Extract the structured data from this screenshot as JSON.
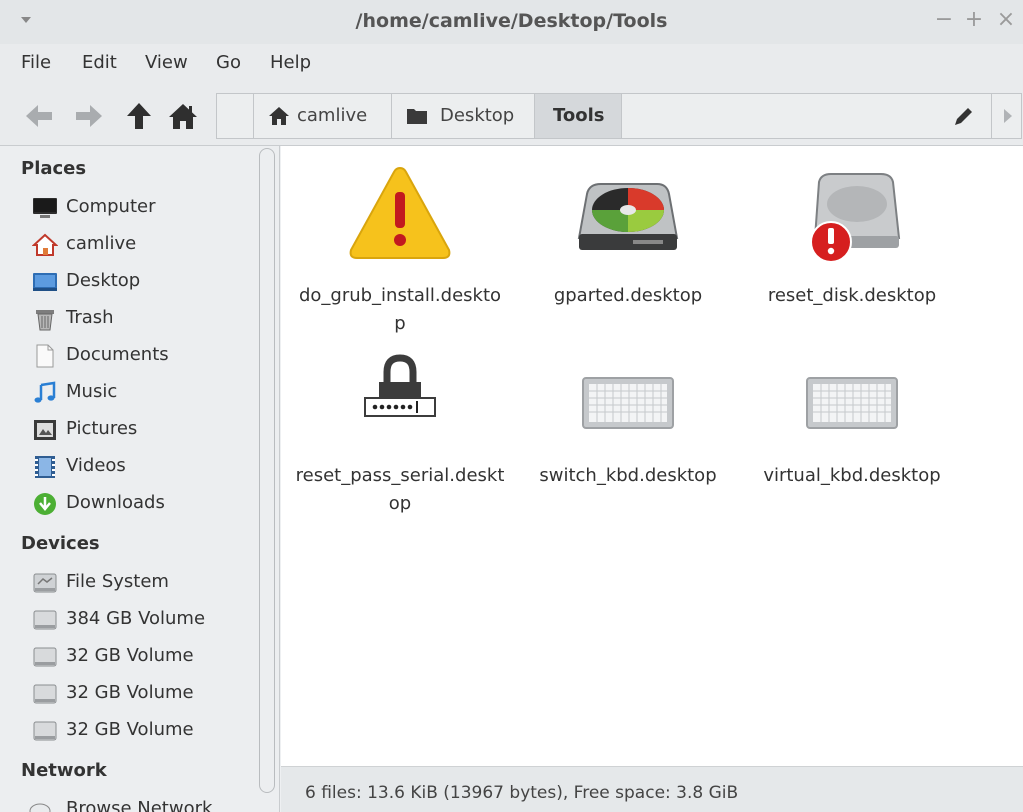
{
  "window": {
    "title": "/home/camlive/Desktop/Tools",
    "minimize_glyph": "−",
    "maximize_glyph": "+",
    "close_glyph": "×"
  },
  "menubar": {
    "items": [
      "File",
      "Edit",
      "View",
      "Go",
      "Help"
    ]
  },
  "toolbar": {
    "icons": [
      "back-arrow-icon",
      "forward-arrow-icon",
      "up-arrow-icon",
      "home-icon",
      "path-left-icon"
    ],
    "breadcrumbs": [
      {
        "label": "camlive",
        "icon": "home-icon"
      },
      {
        "label": "Desktop",
        "icon": "folder-icon"
      },
      {
        "label": "Tools",
        "active": true
      }
    ],
    "edit_icon": "pencil-icon",
    "next_icon": "path-right-icon"
  },
  "sidebar": {
    "places_heading": "Places",
    "places": [
      {
        "label": "Computer",
        "icon": "computer-icon"
      },
      {
        "label": "camlive",
        "icon": "home-icon"
      },
      {
        "label": "Desktop",
        "icon": "desktop-icon"
      },
      {
        "label": "Trash",
        "icon": "trash-icon"
      },
      {
        "label": "Documents",
        "icon": "documents-icon"
      },
      {
        "label": "Music",
        "icon": "music-icon"
      },
      {
        "label": "Pictures",
        "icon": "pictures-icon"
      },
      {
        "label": "Videos",
        "icon": "videos-icon"
      },
      {
        "label": "Downloads",
        "icon": "downloads-icon"
      }
    ],
    "devices_heading": "Devices",
    "devices": [
      {
        "label": "File System",
        "icon": "filesystem-icon"
      },
      {
        "label": "384 GB Volume",
        "icon": "drive-icon"
      },
      {
        "label": "32 GB Volume",
        "icon": "drive-icon"
      },
      {
        "label": "32 GB Volume",
        "icon": "drive-icon"
      },
      {
        "label": "32 GB Volume",
        "icon": "drive-icon"
      }
    ],
    "network_heading": "Network",
    "network": [
      {
        "label": "Browse Network",
        "icon": "network-icon"
      }
    ]
  },
  "files": [
    {
      "name": "do_grub_install.deskto p",
      "icon": "warning-icon"
    },
    {
      "name": "gparted.desktop",
      "icon": "gparted-icon"
    },
    {
      "name": "reset_disk.desktop",
      "icon": "disk-error-icon"
    },
    {
      "name": "reset_pass_serial.deskt op",
      "icon": "password-lock-icon"
    },
    {
      "name": "switch_kbd.desktop",
      "icon": "keyboard-icon"
    },
    {
      "name": "virtual_kbd.desktop",
      "icon": "keyboard-icon"
    }
  ],
  "status": {
    "text": "6 files: 13.6 KiB (13967 bytes), Free space: 3.8 GiB"
  },
  "colors": {
    "warning": "#f6c21c",
    "error": "#d61f1f",
    "folder": "#3a3a3a"
  }
}
